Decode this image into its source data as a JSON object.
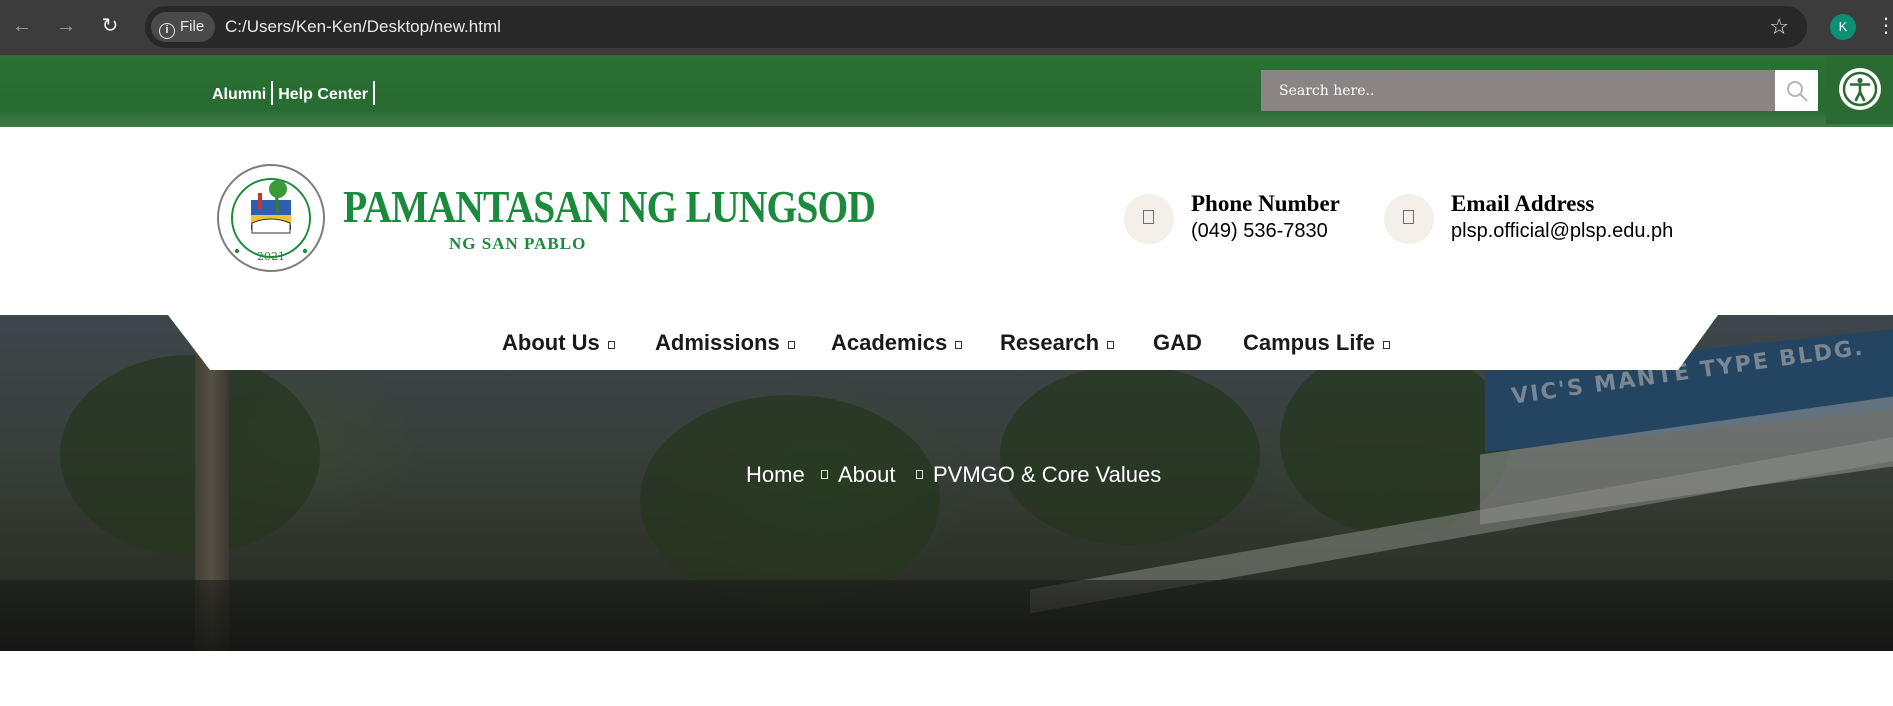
{
  "browser": {
    "back_icon": "arrow-left-icon",
    "forward_icon": "arrow-right-icon",
    "reload_icon": "reload-icon",
    "chip_label": "File",
    "url": "C:/Users/Ken-Ken/Desktop/new.html",
    "profile_initial": "K"
  },
  "topbar": {
    "links": [
      "Alumni",
      "Help Center"
    ],
    "search_placeholder": "Search here..",
    "accent_color": "#2b7034"
  },
  "header": {
    "logo_title": "PAMANTASAN NG LUNGSOD",
    "logo_subtitle": "NG SAN PABLO",
    "seal_year": "2021",
    "phone_title": "Phone Number",
    "phone_value": "(049) 536-7830",
    "email_title": "Email Address",
    "email_value": "plsp.official@plsp.edu.ph"
  },
  "nav": {
    "items": [
      {
        "label": "About Us",
        "dropdown": true
      },
      {
        "label": "Admissions",
        "dropdown": true
      },
      {
        "label": "Academics",
        "dropdown": true
      },
      {
        "label": "Research",
        "dropdown": true
      },
      {
        "label": "GAD",
        "dropdown": false
      },
      {
        "label": "Campus Life",
        "dropdown": true
      }
    ]
  },
  "hero": {
    "building_sign": "VIC'S MANTE TYPE BLDG.",
    "breadcrumb": [
      "Home",
      "About",
      "PVMGO & Core Values"
    ]
  }
}
